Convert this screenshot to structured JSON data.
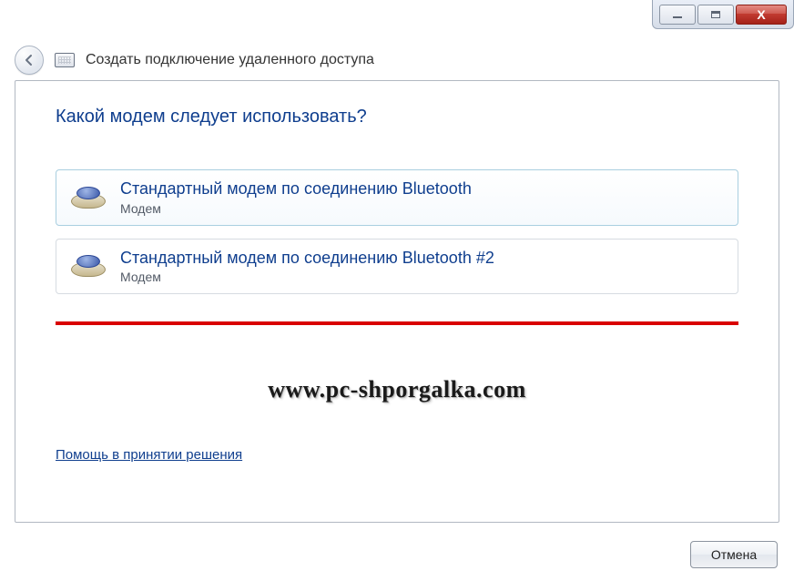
{
  "titlebar": {
    "minimize": "minimize",
    "maximize": "maximize",
    "close": "close"
  },
  "header": {
    "wizard_title": "Создать подключение удаленного доступа"
  },
  "main": {
    "question": "Какой модем следует использовать?",
    "options": [
      {
        "title": "Стандартный модем по соединению Bluetooth",
        "subtitle": "Модем"
      },
      {
        "title": "Стандартный модем по соединению Bluetooth #2",
        "subtitle": "Модем"
      }
    ],
    "watermark": "www.pc-shporgalka.com",
    "help_link": "Помощь в принятии решения"
  },
  "footer": {
    "cancel_label": "Отмена"
  }
}
